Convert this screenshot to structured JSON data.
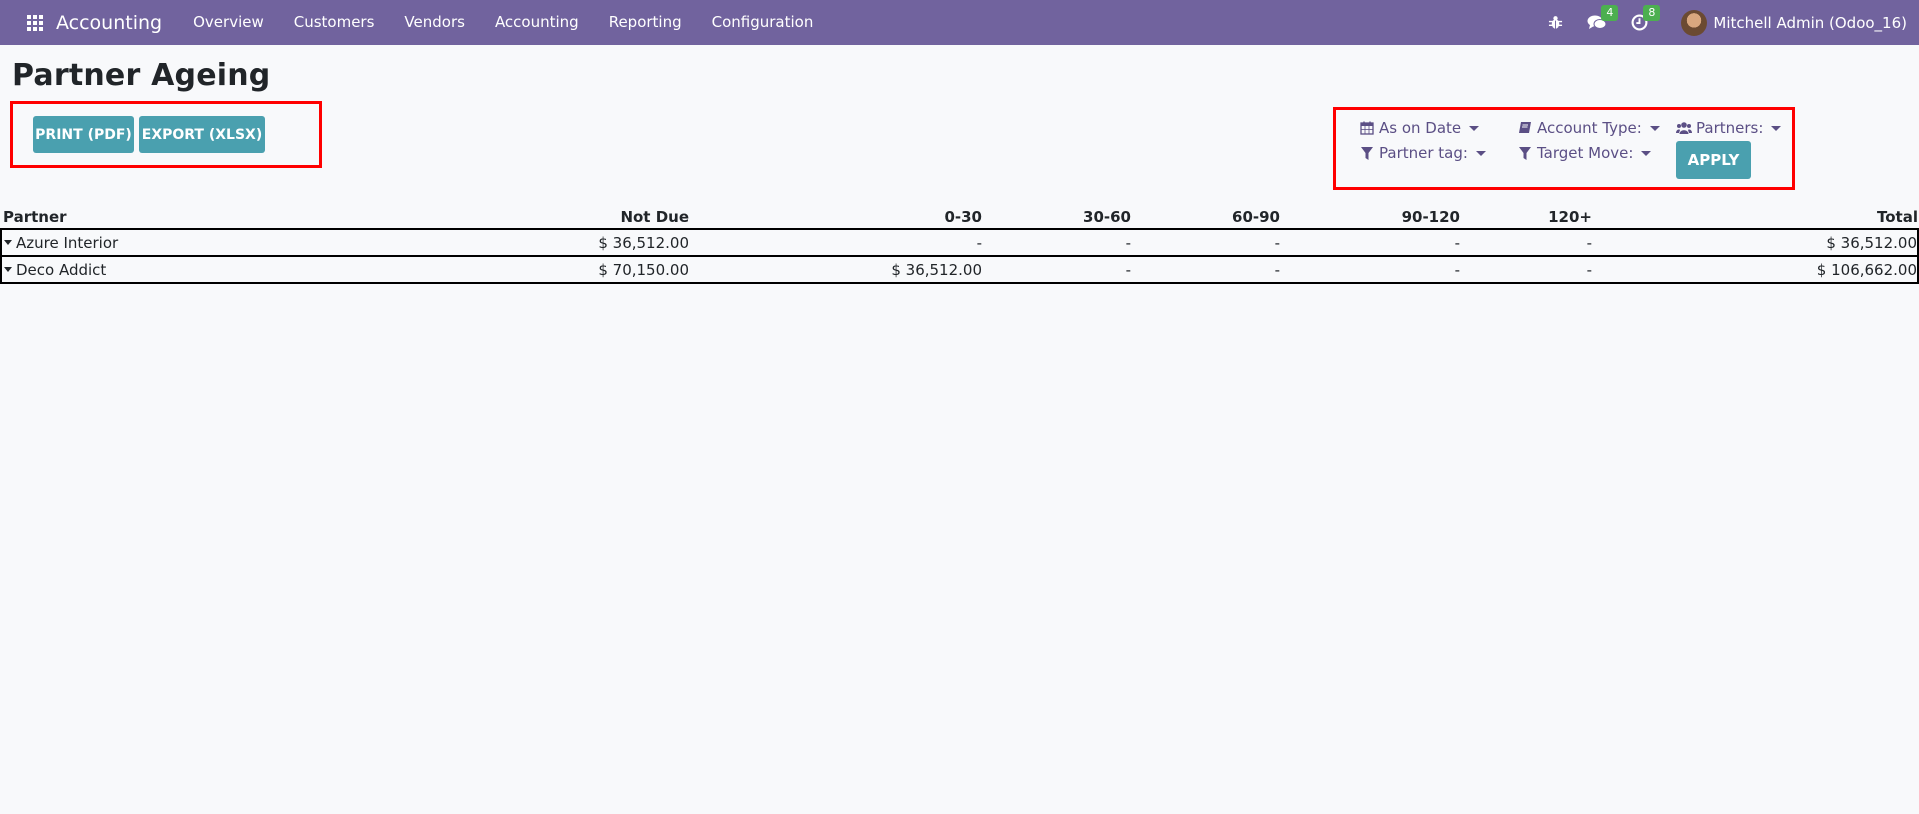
{
  "navbar": {
    "brand": "Accounting",
    "menu": [
      "Overview",
      "Customers",
      "Vendors",
      "Accounting",
      "Reporting",
      "Configuration"
    ],
    "messages_count": "4",
    "activities_count": "8",
    "user_name": "Mitchell Admin (Odoo_16)",
    "colors": {
      "navbar": "#71639e",
      "badge": "#4caf50"
    }
  },
  "page": {
    "title": "Partner Ageing",
    "actions": {
      "print_label": "PRINT (PDF)",
      "export_label": "EXPORT (XLSX)"
    },
    "filters": {
      "as_on_date": "As on Date",
      "account_type": "Account Type:",
      "partners": "Partners:",
      "partner_tag": "Partner tag:",
      "target_move": "Target Move:",
      "apply_label": "APPLY"
    },
    "accent_color": "#4aa0af"
  },
  "table": {
    "columns": [
      "Partner",
      "Not Due",
      "0-30",
      "30-60",
      "60-90",
      "90-120",
      "120+",
      "Total"
    ],
    "rows": [
      {
        "partner": "Azure Interior",
        "not_due": "$ 36,512.00",
        "d0_30": "-",
        "d30_60": "-",
        "d60_90": "-",
        "d90_120": "-",
        "d120p": "-",
        "total": "$ 36,512.00"
      },
      {
        "partner": "Deco Addict",
        "not_due": "$ 70,150.00",
        "d0_30": "$ 36,512.00",
        "d30_60": "-",
        "d60_90": "-",
        "d90_120": "-",
        "d120p": "-",
        "total": "$ 106,662.00"
      }
    ]
  }
}
